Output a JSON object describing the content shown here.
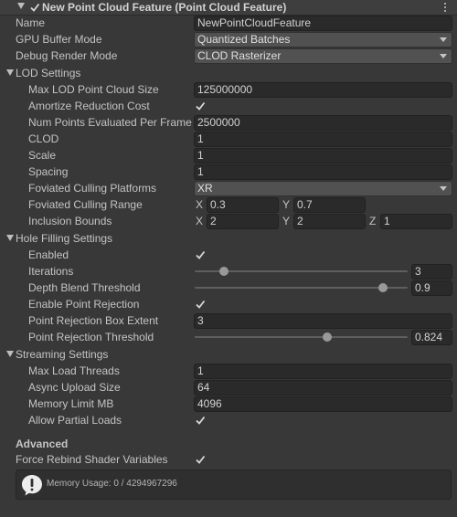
{
  "component": {
    "title": "New Point Cloud Feature (Point Cloud Feature)",
    "enabled": true
  },
  "fields": {
    "name": {
      "label": "Name",
      "value": "NewPointCloudFeature"
    },
    "gpu_buffer_mode": {
      "label": "GPU Buffer Mode",
      "value": "Quantized Batches"
    },
    "debug_render_mode": {
      "label": "Debug Render Mode",
      "value": "CLOD Rasterizer"
    }
  },
  "lod_settings": {
    "header": "LOD Settings",
    "max_lod_point_cloud_size": {
      "label": "Max LOD Point Cloud Size",
      "value": "125000000"
    },
    "amortize_reduction_cost": {
      "label": "Amortize Reduction Cost",
      "checked": true
    },
    "num_points_evaluated_per_frame": {
      "label": "Num Points Evaluated Per Frame",
      "value": "2500000"
    },
    "clod": {
      "label": "CLOD",
      "value": "1"
    },
    "scale": {
      "label": "Scale",
      "value": "1"
    },
    "spacing": {
      "label": "Spacing",
      "value": "1"
    },
    "foviated_culling_platforms": {
      "label": "Foviated Culling Platforms",
      "value": "XR"
    },
    "foviated_culling_range": {
      "label": "Foviated Culling Range",
      "x_label": "X",
      "x": "0.3",
      "y_label": "Y",
      "y": "0.7"
    },
    "inclusion_bounds": {
      "label": "Inclusion Bounds",
      "x_label": "X",
      "x": "2",
      "y_label": "Y",
      "y": "2",
      "z_label": "Z",
      "z": "1"
    }
  },
  "hole_filling": {
    "header": "Hole Filling Settings",
    "enabled": {
      "label": "Enabled",
      "checked": true
    },
    "iterations": {
      "label": "Iterations",
      "value": "3",
      "fraction": 0.12
    },
    "depth_blend_threshold": {
      "label": "Depth Blend Threshold",
      "value": "0.9",
      "fraction": 0.9
    },
    "enable_point_rejection": {
      "label": "Enable Point Rejection",
      "checked": true
    },
    "point_rejection_box_extent": {
      "label": "Point Rejection Box Extent",
      "value": "3"
    },
    "point_rejection_threshold": {
      "label": "Point Rejection Threshold",
      "value": "0.824",
      "fraction": 0.63
    }
  },
  "streaming": {
    "header": "Streaming Settings",
    "max_load_threads": {
      "label": "Max Load Threads",
      "value": "1"
    },
    "async_upload_size": {
      "label": "Async Upload Size",
      "value": "64"
    },
    "memory_limit_mb": {
      "label": "Memory Limit MB",
      "value": "4096"
    },
    "allow_partial_loads": {
      "label": "Allow Partial Loads",
      "checked": true
    }
  },
  "advanced": {
    "header": "Advanced",
    "force_rebind_shader_variables": {
      "label": "Force Rebind Shader Variables",
      "checked": true
    }
  },
  "help_box": {
    "message": "Memory Usage: 0 / 4294967296",
    "icon": "warning-icon"
  },
  "colors": {
    "background": "#383838",
    "field": "#2a2a2a",
    "dropdown": "#515151",
    "text": "#c4c4c4"
  }
}
